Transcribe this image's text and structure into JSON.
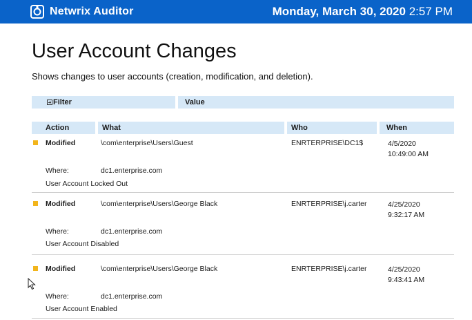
{
  "header": {
    "app_title": "Netwrix Auditor",
    "date": "Monday, March 30, 2020",
    "time": "2:57 PM",
    "logo_icon": "netwrix-logo-icon",
    "colors": {
      "bar": "#0a63c9",
      "text": "#ffffff"
    }
  },
  "report": {
    "title": "User Account Changes",
    "subtitle": "Shows changes to user accounts (creation, modification, and deletion)."
  },
  "filter": {
    "filter_label": "Filter",
    "value_label": "Value",
    "toggle_icon": "expand-plus-icon"
  },
  "columns": {
    "action": "Action",
    "what": "What",
    "who": "Who",
    "when": "When"
  },
  "rows": [
    {
      "action": "Modified",
      "what": "\\com\\enterprise\\Users\\Guest",
      "who": "ENRTERPRISE\\DC1$",
      "when_date": "4/5/2020",
      "when_time": "10:49:00 AM",
      "where_label": "Where:",
      "where_value": "dc1.enterprise.com",
      "detail": "User Account Locked Out"
    },
    {
      "action": "Modified",
      "what": "\\com\\enterprise\\Users\\George Black",
      "who": "ENRTERPRISE\\j.carter",
      "when_date": "4/25/2020",
      "when_time": "9:32:17 AM",
      "where_label": "Where:",
      "where_value": "dc1.enterprise.com",
      "detail": "User Account Disabled"
    },
    {
      "action": "Modified",
      "what": "\\com\\enterprise\\Users\\George Black",
      "who": "ENRTERPRISE\\j.carter",
      "when_date": "4/25/2020",
      "when_time": "9:43:41 AM",
      "where_label": "Where:",
      "where_value": "dc1.enterprise.com",
      "detail": "User Account Enabled"
    }
  ],
  "colors": {
    "header_fill": "#d6e8f7",
    "marker": "#f2b51c"
  }
}
